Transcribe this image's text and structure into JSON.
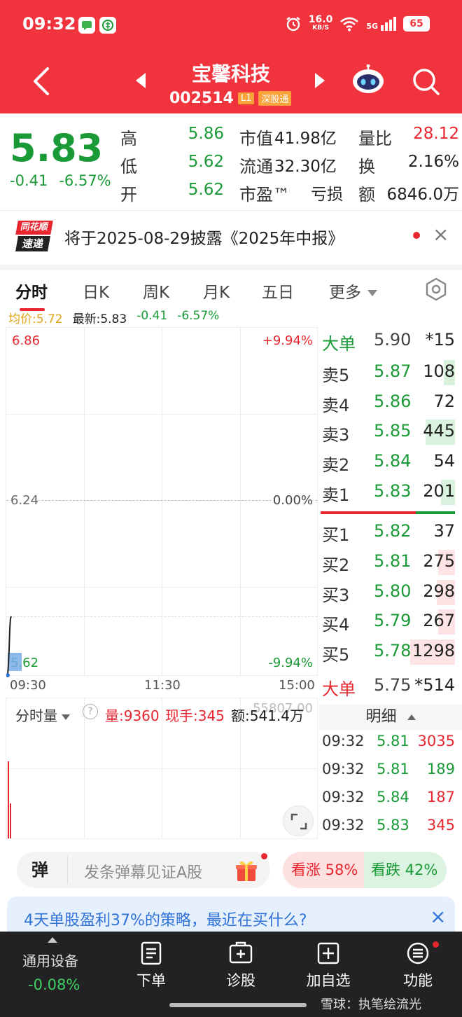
{
  "status_bar": {
    "time": "09:32",
    "net_speed": "16.0",
    "net_unit": "KB/S",
    "signal": "5G",
    "battery": "65"
  },
  "header": {
    "title": "宝馨科技",
    "code": "002514",
    "level_tag": "L1",
    "market_tag": "深股通"
  },
  "quote": {
    "price": "5.83",
    "change": "-0.41",
    "change_pct": "-6.57%",
    "high_label": "高",
    "high": "5.86",
    "low_label": "低",
    "low": "5.62",
    "open_label": "开",
    "open": "5.62",
    "mcap_label": "市值",
    "mcap": "41.98亿",
    "float_label": "流通",
    "float": "32.30亿",
    "pe_label": "市盈™",
    "pe": "亏损",
    "vr_label": "量比",
    "vr": "28.12",
    "turn_label": "换",
    "turn": "2.16%",
    "amt_label": "额",
    "amt": "6846.0万"
  },
  "notice": {
    "logo_top": "同花顺",
    "logo_bottom": "速递",
    "text": "将于2025-08-29披露《2025年中报》",
    "close": "×"
  },
  "tabs": [
    "分时",
    "日K",
    "周K",
    "月K",
    "五日",
    "更多"
  ],
  "info_line": {
    "avg": "均价:5.72",
    "latest": "最新:5.83",
    "chg": "-0.41",
    "pct": "-6.57%"
  },
  "chart": {
    "top_price": "6.86",
    "top_pct": "+9.94%",
    "mid_price": "6.24",
    "mid_pct": "0.00%",
    "bottom_price": "5.62",
    "bottom_pct": "-9.94%",
    "time_start": "09:30",
    "time_mid": "11:30",
    "time_end": "15:00"
  },
  "order_book": {
    "big_sell": {
      "label": "大单",
      "price": "5.90",
      "vol": "*15"
    },
    "asks": [
      {
        "label": "卖5",
        "price": "5.87",
        "vol": "108"
      },
      {
        "label": "卖4",
        "price": "5.86",
        "vol": "72"
      },
      {
        "label": "卖3",
        "price": "5.85",
        "vol": "445"
      },
      {
        "label": "卖2",
        "price": "5.84",
        "vol": "54"
      },
      {
        "label": "卖1",
        "price": "5.83",
        "vol": "201"
      }
    ],
    "bids": [
      {
        "label": "买1",
        "price": "5.82",
        "vol": "37"
      },
      {
        "label": "买2",
        "price": "5.81",
        "vol": "275"
      },
      {
        "label": "买3",
        "price": "5.80",
        "vol": "298"
      },
      {
        "label": "买4",
        "price": "5.79",
        "vol": "267"
      },
      {
        "label": "买5",
        "price": "5.78",
        "vol": "1298"
      }
    ],
    "big_buy": {
      "label": "大单",
      "price": "5.75",
      "vol": "*514"
    }
  },
  "volume": {
    "selector": "分时量",
    "vol": "量:9360",
    "hand": "现手:345",
    "amount": "额:541.4万",
    "axis_max": "55807.00"
  },
  "detail": {
    "title": "明细",
    "rows": [
      {
        "time": "09:32",
        "price": "5.81",
        "vol": "3035"
      },
      {
        "time": "09:32",
        "price": "5.81",
        "vol": "189"
      },
      {
        "time": "09:32",
        "price": "5.84",
        "vol": "187"
      },
      {
        "time": "09:32",
        "price": "5.83",
        "vol": "345"
      }
    ]
  },
  "danmu": {
    "icon": "弹",
    "placeholder": "发条弹幕见证A股",
    "up": "看涨 58%",
    "down": "看跌 42%"
  },
  "promo": {
    "text": "4天单股盈利37%的策略，最近在买什么?",
    "close": "×"
  },
  "bottom": {
    "index_name": "通用设备",
    "index_chg": "-0.08%",
    "items": [
      "下单",
      "诊股",
      "加自选",
      "功能"
    ],
    "watermark": "雪球：执笔绘流光"
  },
  "colors": {
    "header_red": "#f0333d",
    "up_red": "#e8262f",
    "down_green": "#1a9a37"
  }
}
